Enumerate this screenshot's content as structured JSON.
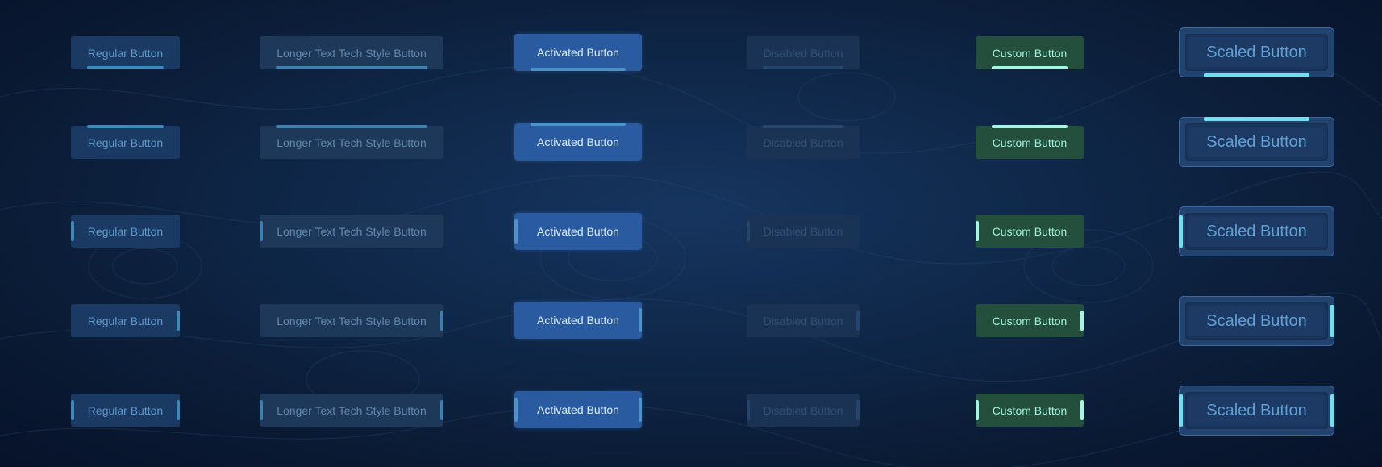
{
  "background": {
    "base_color": "#0f2748",
    "contour_color": "#2a4d78"
  },
  "button_variants": {
    "regular": "Regular Button",
    "longer": "Longer Text Tech Style Button",
    "activated": "Activated Button",
    "disabled": "Disabled Button",
    "custom": "Custom Button",
    "scaled": "Scaled Button"
  },
  "indicator_rows": [
    "bottom",
    "top",
    "left",
    "right",
    "left-right"
  ],
  "colors": {
    "regular_bg": "#1b3a63",
    "activated_bg": "#2a5ba0",
    "disabled_bg": "#1a3354",
    "custom_bg": "#254f3d",
    "custom_accent": "#a8f4e3",
    "scaled_accent": "#6fe1ee"
  }
}
